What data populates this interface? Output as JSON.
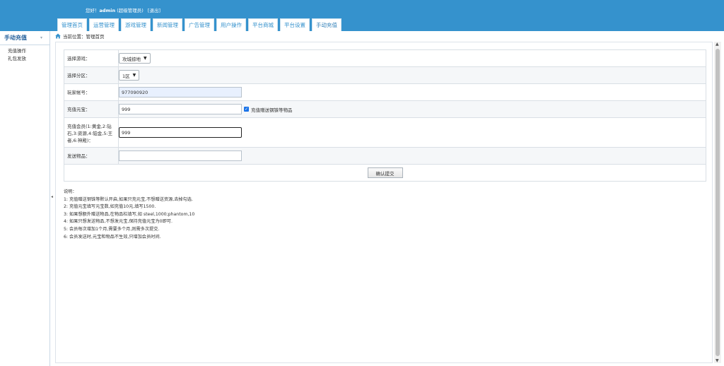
{
  "header": {
    "welcome_prefix": "您好！",
    "username": "admin",
    "role": "(超级管理员)",
    "logout_label": "[退出]",
    "tabs": [
      {
        "label": "管理首页"
      },
      {
        "label": "运营管理"
      },
      {
        "label": "游戏管理"
      },
      {
        "label": "新闻管理"
      },
      {
        "label": "广告管理"
      },
      {
        "label": "用户操作"
      },
      {
        "label": "平台商城"
      },
      {
        "label": "平台设置"
      },
      {
        "label": "手动充值"
      }
    ]
  },
  "sidebar": {
    "title": "手动充值",
    "items": [
      {
        "label": "充值操作"
      },
      {
        "label": "礼包发放"
      }
    ]
  },
  "breadcrumb": {
    "prefix": "当前位置：",
    "current": "管理首页"
  },
  "form": {
    "game_label": "选择游戏：",
    "game_value": "攻城掠地",
    "zone_label": "选择分区：",
    "zone_value": "1区",
    "account_label": "玩家帐号：",
    "account_value": "977090920",
    "ingot_label": "充值元宝：",
    "ingot_value": "999",
    "extra_checkbox_label": "充值赠送钢铢等物品",
    "extra_checked": true,
    "vip_label": "充值会员(1:黄金,2:钻石,3:资源,4:铂金,5:王者,6:神殿)：",
    "vip_value": "999",
    "items_label": "发送物品：",
    "items_value": "",
    "submit_label": "确认提交"
  },
  "notes": {
    "title": "说明：",
    "lines": [
      "1: 充值赠送钢铢等默认开启,如果只充元宝,不想赠送资源,去掉勾选.",
      "2: 充值元宝填写元宝数,如充值10元,填写1500.",
      "3: 如果想额外赠送物品,在物品栏填写,如 steel,1000;phantom,10",
      "4: 如果只想发送物品,不想发元宝,保持充值元宝为0即可.",
      "5: 会员每次增加1个月,需要多个月,则需多次提交.",
      "6: 会员发送时,元宝和物品不生效,只增加会员时间."
    ]
  },
  "colors": {
    "header_bg": "#3592cd",
    "accent": "#1f5c99",
    "checkbox": "#1a73e8"
  }
}
